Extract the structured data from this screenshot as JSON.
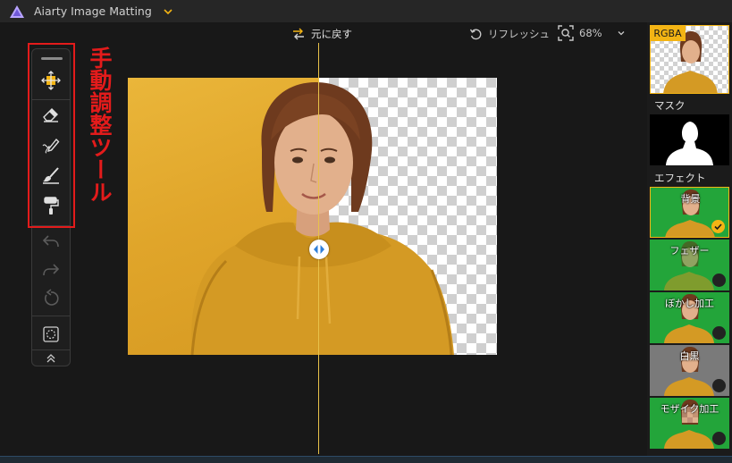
{
  "app": {
    "title": "Aiarty Image Matting"
  },
  "toolbar": {
    "undo_label": "元に戻す",
    "refresh_label": "リフレッシュ",
    "zoom": "68%"
  },
  "annotation": {
    "text": "手動調整ツール"
  },
  "tools": [
    {
      "icon": "move-icon"
    },
    {
      "icon": "eraser-icon"
    },
    {
      "icon": "pencil-icon"
    },
    {
      "icon": "brush-icon"
    },
    {
      "icon": "paint-roller-icon"
    },
    {
      "icon": "undo-arrow-icon"
    },
    {
      "icon": "redo-arrow-icon"
    },
    {
      "icon": "reset-icon"
    },
    {
      "icon": "selection-icon"
    },
    {
      "icon": "collapse-up-icon"
    }
  ],
  "preview": {
    "rgba_label": "RGBA",
    "mask_label": "マスク",
    "effects_label": "エフェクト",
    "effects": [
      {
        "label": "背景",
        "selected": true
      },
      {
        "label": "フェザー",
        "selected": false
      },
      {
        "label": "ぼかし加工",
        "selected": false
      },
      {
        "label": "白黒",
        "selected": false
      },
      {
        "label": "モザイク加工",
        "selected": false
      }
    ]
  },
  "colors": {
    "accent": "#f3b414",
    "annotation": "#e31b1b",
    "split_line": "#e8c24a",
    "effect_bg": "#23a53a"
  }
}
